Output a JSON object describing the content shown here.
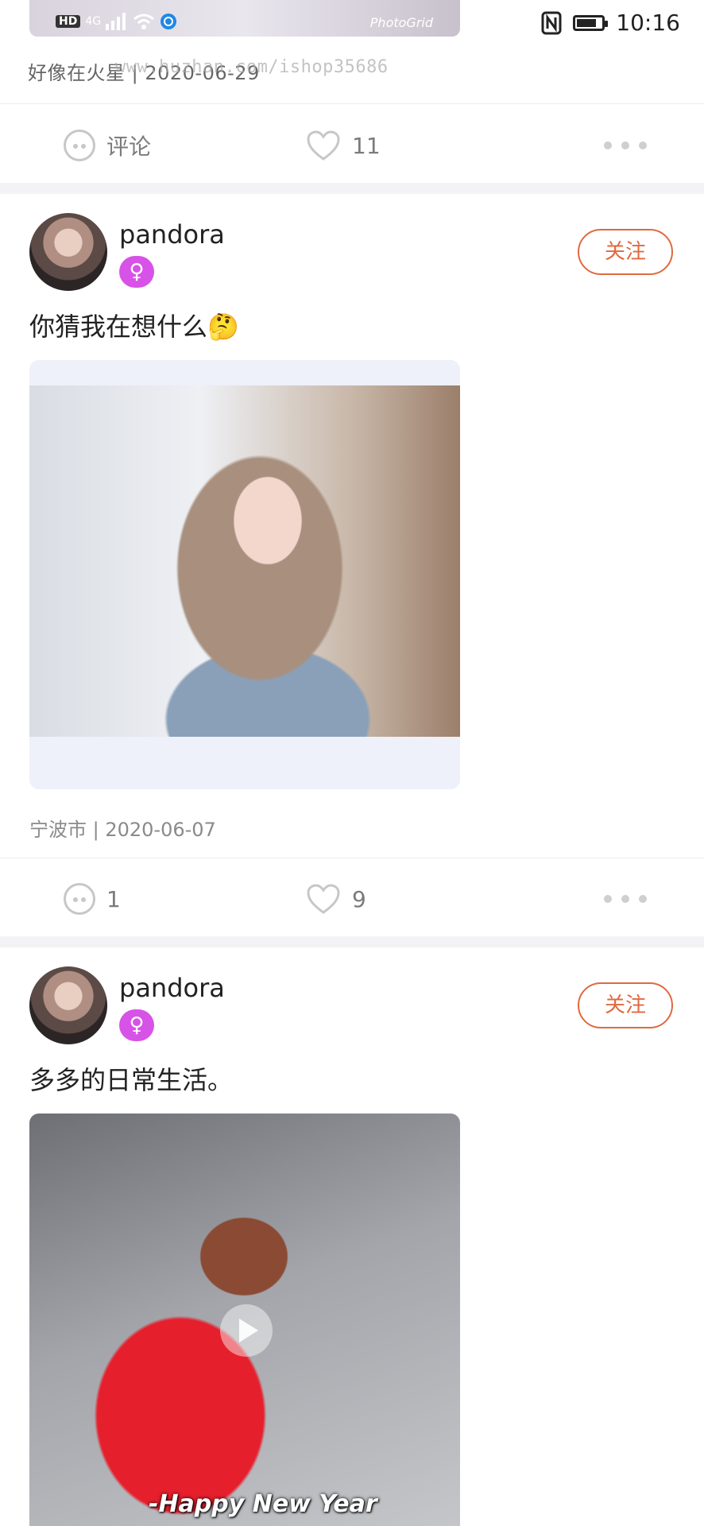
{
  "status_bar": {
    "network": "4G",
    "hd": "HD",
    "nfc": "N",
    "time": "10:16"
  },
  "previous_post": {
    "image_overlay": "PhotoGrid",
    "meta": "好像在火星 | 2020-06-29",
    "watermark_url": "www.huzhan.com/ishop35686",
    "comment_label": "评论",
    "like_count": "11"
  },
  "posts": [
    {
      "username": "pandora",
      "gender_symbol": "♀",
      "follow_label": "关注",
      "text": "你猜我在想什么🤔",
      "meta": "宁波市 | 2020-06-07",
      "comment_count": "1",
      "like_count": "9"
    },
    {
      "username": "pandora",
      "gender_symbol": "♀",
      "follow_label": "关注",
      "text": "多多的日常生活。",
      "video_caption": "-Happy New Year"
    }
  ],
  "colors": {
    "accent": "#e0693f",
    "gender_badge": "#d752e6",
    "icon_gray": "#c7c7c7"
  },
  "icons": [
    "comment-icon",
    "heart-icon",
    "more-icon",
    "play-icon",
    "female-icon",
    "wifi-icon",
    "signal-icon",
    "battery-icon",
    "nfc-icon"
  ]
}
